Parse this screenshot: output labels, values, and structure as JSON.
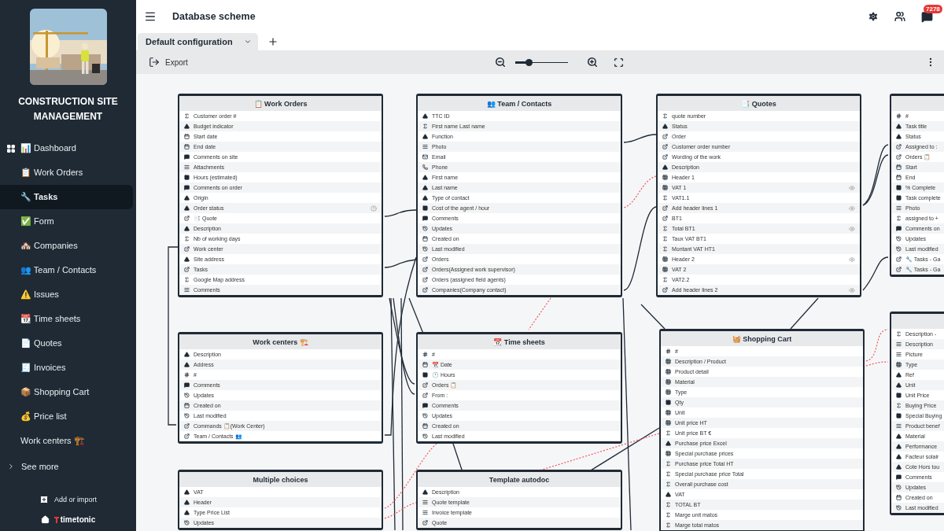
{
  "sidebar": {
    "app_title": "CONSTRUCTION SITE MANAGEMENT",
    "items": [
      {
        "label": "📊 Dashboard",
        "kind": "dashboard",
        "selected": false
      },
      {
        "label": "📋 Work Orders",
        "kind": "page",
        "selected": false
      },
      {
        "label": "🔧 Tasks",
        "kind": "page",
        "selected": true
      },
      {
        "label": "✅ Form",
        "kind": "page",
        "selected": false
      },
      {
        "label": "🏘️ Companies",
        "kind": "page",
        "selected": false
      },
      {
        "label": "👥 Team / Contacts",
        "kind": "page",
        "selected": false
      },
      {
        "label": "⚠️ Issues",
        "kind": "page",
        "selected": false
      },
      {
        "label": "📆 Time sheets",
        "kind": "page",
        "selected": false
      },
      {
        "label": "📄 Quotes",
        "kind": "page",
        "selected": false
      },
      {
        "label": "🧾 Invoices",
        "kind": "page",
        "selected": false
      },
      {
        "label": "📦 Shopping Cart",
        "kind": "page",
        "selected": false
      },
      {
        "label": "💰 Price list",
        "kind": "page",
        "selected": false
      },
      {
        "label": "Work centers 🏗️",
        "kind": "page",
        "selected": false
      }
    ],
    "more": "See more",
    "add": "Add or import",
    "brand": "timetonic"
  },
  "header": {
    "title": "Database scheme",
    "badge": "7278"
  },
  "tabs": [
    {
      "label": "Default configuration",
      "selected": true
    }
  ],
  "toolbar": {
    "export": "Export",
    "zoom": {
      "level": 0.25
    }
  },
  "tables": [
    {
      "title": "📋 Work Orders",
      "fields": [
        {
          "name": "Customer order #",
          "kind": "formula"
        },
        {
          "name": "Budget indicator",
          "kind": "text"
        },
        {
          "name": "Start date",
          "kind": "date"
        },
        {
          "name": "End date",
          "kind": "date"
        },
        {
          "name": "Comments on site",
          "kind": "comment"
        },
        {
          "name": "Attachments",
          "kind": "file"
        },
        {
          "name": "Hours (estimated)",
          "kind": "number"
        },
        {
          "name": "Comments on order",
          "kind": "comment"
        },
        {
          "name": "Origin",
          "kind": "text"
        },
        {
          "name": "Order status",
          "kind": "text",
          "help": true
        },
        {
          "name": "📑 Quote",
          "kind": "link"
        },
        {
          "name": "Description",
          "kind": "text"
        },
        {
          "name": "Nb of working days",
          "kind": "formula"
        },
        {
          "name": "Work center",
          "kind": "link"
        },
        {
          "name": "Site address",
          "kind": "text"
        },
        {
          "name": "Tasks",
          "kind": "link"
        },
        {
          "name": "Google Map address",
          "kind": "formula"
        },
        {
          "name": "Comments",
          "kind": "file"
        }
      ]
    },
    {
      "title": "👥 Team / Contacts",
      "fields": [
        {
          "name": "TTC ID",
          "kind": "text"
        },
        {
          "name": "First name Last name",
          "kind": "formula"
        },
        {
          "name": "Function",
          "kind": "text"
        },
        {
          "name": "Photo",
          "kind": "file"
        },
        {
          "name": "Email",
          "kind": "email"
        },
        {
          "name": "Phone",
          "kind": "phone"
        },
        {
          "name": "First name",
          "kind": "text"
        },
        {
          "name": "Last name",
          "kind": "text"
        },
        {
          "name": "Type of contact",
          "kind": "text"
        },
        {
          "name": "Cost of the agent / hour",
          "kind": "number"
        },
        {
          "name": "Comments",
          "kind": "comment"
        },
        {
          "name": "Updates",
          "kind": "history"
        },
        {
          "name": "Created on",
          "kind": "date"
        },
        {
          "name": "Last modified",
          "kind": "history"
        },
        {
          "name": "Orders",
          "kind": "link"
        },
        {
          "name": "Orders(Assigned work supervisor)",
          "kind": "link"
        },
        {
          "name": "Orders (assigned field agents)",
          "kind": "link"
        },
        {
          "name": "Companies(Company contact)",
          "kind": "link"
        }
      ]
    },
    {
      "title": "📑 Quotes",
      "fields": [
        {
          "name": "quote number",
          "kind": "formula"
        },
        {
          "name": "Status",
          "kind": "text"
        },
        {
          "name": "Order",
          "kind": "link"
        },
        {
          "name": "Customer order number",
          "kind": "link"
        },
        {
          "name": "Wording of the work",
          "kind": "link"
        },
        {
          "name": "Description",
          "kind": "text"
        },
        {
          "name": "Header 1",
          "kind": "list"
        },
        {
          "name": "VAT 1",
          "kind": "list",
          "eye": true
        },
        {
          "name": "VAT1.1",
          "kind": "formula"
        },
        {
          "name": "Add header lines 1",
          "kind": "link",
          "eye": true
        },
        {
          "name": "BT1",
          "kind": "link"
        },
        {
          "name": "Total BT1",
          "kind": "formula",
          "eye": true
        },
        {
          "name": "Taux VAT BT1",
          "kind": "formula"
        },
        {
          "name": "Montant VAT HT1",
          "kind": "formula"
        },
        {
          "name": "Header 2",
          "kind": "list",
          "eye": true
        },
        {
          "name": "VAT 2",
          "kind": "list"
        },
        {
          "name": "VAT2.2",
          "kind": "formula"
        },
        {
          "name": "Add header lines 2",
          "kind": "link",
          "eye": true
        }
      ]
    },
    {
      "fields": [
        {
          "name": "#",
          "kind": "id"
        },
        {
          "name": "Task title",
          "kind": "text"
        },
        {
          "name": "Status",
          "kind": "text"
        },
        {
          "name": "Assigned to :",
          "kind": "link"
        },
        {
          "name": "Orders 📋",
          "kind": "link"
        },
        {
          "name": "Start",
          "kind": "date"
        },
        {
          "name": "End",
          "kind": "date"
        },
        {
          "name": "% Complete",
          "kind": "number"
        },
        {
          "name": "Task complete",
          "kind": "number"
        },
        {
          "name": "Photo",
          "kind": "file"
        },
        {
          "name": "assigned to +",
          "kind": "formula"
        },
        {
          "name": "Comments on",
          "kind": "comment"
        },
        {
          "name": "Updates",
          "kind": "history"
        },
        {
          "name": "Last modified",
          "kind": "history"
        },
        {
          "name": "🔧 Tasks - Ga",
          "kind": "link"
        },
        {
          "name": "🔧 Tasks - Ga",
          "kind": "link"
        }
      ]
    },
    {
      "title": "Work centers 🏗️",
      "fields": [
        {
          "name": "Description",
          "kind": "text"
        },
        {
          "name": "Address",
          "kind": "text"
        },
        {
          "name": "#",
          "kind": "id"
        },
        {
          "name": "Comments",
          "kind": "comment"
        },
        {
          "name": "Updates",
          "kind": "history"
        },
        {
          "name": "Created on",
          "kind": "date"
        },
        {
          "name": "Last modified",
          "kind": "history"
        },
        {
          "name": "Commands 📋(Work Center)",
          "kind": "link"
        },
        {
          "name": "Team / Contacts 👥",
          "kind": "link"
        }
      ]
    },
    {
      "title": "📆 Time sheets",
      "fields": [
        {
          "name": "#",
          "kind": "id"
        },
        {
          "name": "📆 Date",
          "kind": "date"
        },
        {
          "name": "🕐 Hours",
          "kind": "number"
        },
        {
          "name": "Orders 📋",
          "kind": "link"
        },
        {
          "name": "From :",
          "kind": "link"
        },
        {
          "name": "Comments",
          "kind": "comment"
        },
        {
          "name": "Updates",
          "kind": "history"
        },
        {
          "name": "Created on",
          "kind": "date"
        },
        {
          "name": "Last modified",
          "kind": "history"
        }
      ]
    },
    {
      "title": "🧺 Shopping Cart",
      "fields": [
        {
          "name": "#",
          "kind": "id"
        },
        {
          "name": "Description / Product",
          "kind": "list"
        },
        {
          "name": "Product detail",
          "kind": "list"
        },
        {
          "name": "Material",
          "kind": "list"
        },
        {
          "name": "Type",
          "kind": "list"
        },
        {
          "name": "Qty",
          "kind": "number"
        },
        {
          "name": "Unit",
          "kind": "list"
        },
        {
          "name": "Unit price HT",
          "kind": "list"
        },
        {
          "name": "Unit price BT €",
          "kind": "formula"
        },
        {
          "name": "Purchase price Excel",
          "kind": "text"
        },
        {
          "name": "Special purchase prices",
          "kind": "list"
        },
        {
          "name": "Purchase price Total HT",
          "kind": "formula"
        },
        {
          "name": "Special purchase price Total",
          "kind": "formula"
        },
        {
          "name": "Overall purchase cost",
          "kind": "formula"
        },
        {
          "name": "VAT",
          "kind": "text"
        },
        {
          "name": "TOTAL BT",
          "kind": "formula"
        },
        {
          "name": "Marge unit matos",
          "kind": "formula"
        },
        {
          "name": "Marge total matos",
          "kind": "formula"
        }
      ]
    },
    {
      "fields": [
        {
          "name": "Description -",
          "kind": "formula"
        },
        {
          "name": "Description",
          "kind": "file"
        },
        {
          "name": "Picture",
          "kind": "file"
        },
        {
          "name": "Type",
          "kind": "list"
        },
        {
          "name": "Ref",
          "kind": "text"
        },
        {
          "name": "Unit",
          "kind": "text"
        },
        {
          "name": "Unit Price",
          "kind": "number"
        },
        {
          "name": "Buying Price",
          "kind": "formula"
        },
        {
          "name": "Special Buying",
          "kind": "number"
        },
        {
          "name": "Product benef",
          "kind": "file"
        },
        {
          "name": "Material",
          "kind": "text"
        },
        {
          "name": "Performance",
          "kind": "text"
        },
        {
          "name": "Facteur solair",
          "kind": "text"
        },
        {
          "name": "Cote Hors tou",
          "kind": "text"
        },
        {
          "name": "Comments",
          "kind": "comment"
        },
        {
          "name": "Updates",
          "kind": "history"
        },
        {
          "name": "Created on",
          "kind": "date"
        },
        {
          "name": "Last modified",
          "kind": "history"
        }
      ]
    },
    {
      "title": "Multiple choices",
      "fields": [
        {
          "name": "VAT",
          "kind": "text"
        },
        {
          "name": "Header",
          "kind": "text"
        },
        {
          "name": "Type Price List",
          "kind": "text"
        },
        {
          "name": "Updates",
          "kind": "history"
        }
      ]
    },
    {
      "title": "Template autodoc",
      "fields": [
        {
          "name": "Description",
          "kind": "text"
        },
        {
          "name": "Quote template",
          "kind": "file"
        },
        {
          "name": "Invoice template",
          "kind": "file"
        },
        {
          "name": "Quote",
          "kind": "link"
        }
      ]
    }
  ]
}
